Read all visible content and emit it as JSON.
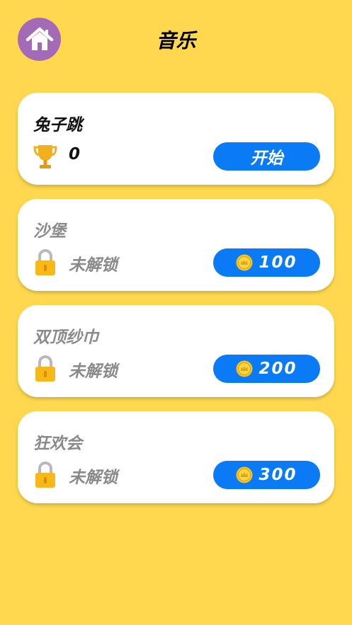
{
  "header": {
    "title": "音乐",
    "home_icon": "home-icon"
  },
  "songs": [
    {
      "title": "兔子跳",
      "status_icon": "trophy-icon",
      "status_text": "0",
      "button_label": "开始",
      "locked": false
    },
    {
      "title": "沙堡",
      "status_icon": "lock-icon",
      "status_text": "未解锁",
      "price": "100",
      "locked": true
    },
    {
      "title": "双顶纱巾",
      "status_icon": "lock-icon",
      "status_text": "未解锁",
      "price": "200",
      "locked": true
    },
    {
      "title": "狂欢会",
      "status_icon": "lock-icon",
      "status_text": "未解锁",
      "price": "300",
      "locked": true
    }
  ],
  "colors": {
    "background": "#FFD84F",
    "home_button": "#A36AB7",
    "button_blue": "#0A7AF5",
    "locked_text": "#8A8A8A"
  }
}
